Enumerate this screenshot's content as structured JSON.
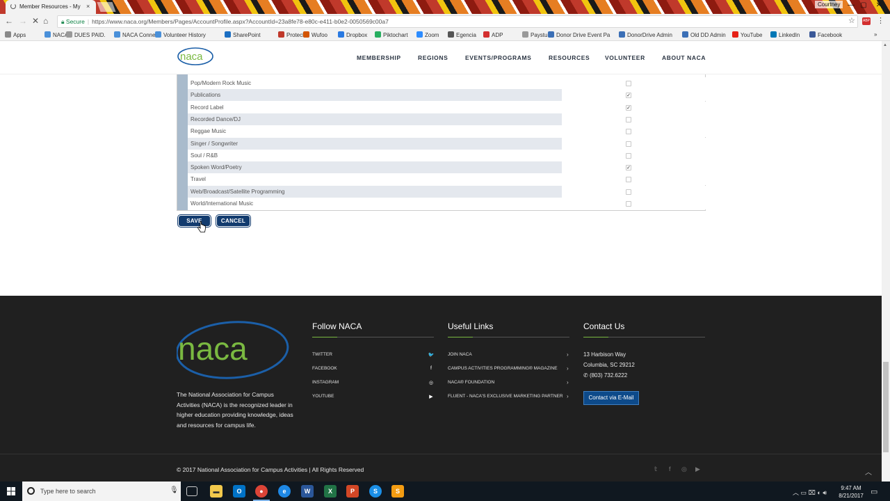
{
  "browser": {
    "tab_title": "Member Resources - My",
    "tab_close": "×",
    "profile": "Courtney",
    "minimize": "—",
    "maximize": "▢",
    "close": "✕",
    "secure_label": "Secure",
    "url": "https://www.naca.org/Members/Pages/AccountProfile.aspx?AccountId=23a8fe78-e80c-e411-b0e2-0050569c00a7",
    "ext_label": "ABP",
    "bookmarks": [
      {
        "label": "Apps",
        "color": "#888"
      },
      {
        "label": "NACA",
        "color": "#4a90d9"
      },
      {
        "label": "DUES PAID.",
        "color": "#999"
      },
      {
        "label": "NACA Connect",
        "color": "#4a90d9"
      },
      {
        "label": "Volunteer History",
        "color": "#4a90d9"
      },
      {
        "label": "SharePoint",
        "color": "#1b6ec2"
      },
      {
        "label": "Protech",
        "color": "#c0392b"
      },
      {
        "label": "Wufoo",
        "color": "#d35400"
      },
      {
        "label": "Dropbox",
        "color": "#2a7ae2"
      },
      {
        "label": "Piktochart",
        "color": "#27ae60"
      },
      {
        "label": "Zoom",
        "color": "#2d8cff"
      },
      {
        "label": "Egencia",
        "color": "#555"
      },
      {
        "label": "ADP",
        "color": "#d32f2f"
      },
      {
        "label": "Paystub",
        "color": "#999"
      },
      {
        "label": "Donor Drive Event Pa",
        "color": "#3b6fb6"
      },
      {
        "label": "DonorDrive Admin",
        "color": "#3b6fb6"
      },
      {
        "label": "Old DD Admin",
        "color": "#3b6fb6"
      },
      {
        "label": "YouTube",
        "color": "#e62117"
      },
      {
        "label": "LinkedIn",
        "color": "#0077b5"
      },
      {
        "label": "Facebook",
        "color": "#3b5998"
      }
    ],
    "more": "»"
  },
  "site": {
    "logo_text": "naca",
    "nav": [
      "MEMBERSHIP",
      "REGIONS",
      "EVENTS/PROGRAMS",
      "RESOURCES",
      "VOLUNTEER",
      "ABOUT NACA"
    ]
  },
  "table": {
    "rows": [
      {
        "label": "Pop/Modern Rock Music",
        "checked": false
      },
      {
        "label": "Publications",
        "checked": true
      },
      {
        "label": "Record Label",
        "checked": true
      },
      {
        "label": "Recorded Dance/DJ",
        "checked": false
      },
      {
        "label": "Reggae Music",
        "checked": false
      },
      {
        "label": "Singer / Songwriter",
        "checked": false
      },
      {
        "label": "Soul / R&B",
        "checked": false
      },
      {
        "label": "Spoken Word/Poetry",
        "checked": true
      },
      {
        "label": "Travel",
        "checked": false
      },
      {
        "label": "Web/Broadcast/Satellite Programming",
        "checked": false
      },
      {
        "label": "World/International Music",
        "checked": false
      }
    ]
  },
  "actions": {
    "save": "SAVE",
    "cancel": "CANCEL"
  },
  "footer": {
    "logo_text": "naca",
    "about": "The National Association for Campus Activities (NACA) is the recognized leader in higher education providing knowledge, ideas and resources for campus life.",
    "follow_title": "Follow NACA",
    "follow_links": [
      {
        "label": "TWITTER",
        "icon": "twitter-icon",
        "glyph": "🐦"
      },
      {
        "label": "FACEBOOK",
        "icon": "facebook-icon",
        "glyph": "f"
      },
      {
        "label": "INSTAGRAM",
        "icon": "instagram-icon",
        "glyph": "◎"
      },
      {
        "label": "YOUTUBE",
        "icon": "youtube-icon",
        "glyph": "▶"
      }
    ],
    "useful_title": "Useful Links",
    "useful_links": [
      "JOIN NACA",
      "CAMPUS ACTIVITIES PROGRAMMING® MAGAZINE",
      "NACA® FOUNDATION",
      "FLUENT - NACA'S EXCLUSIVE MARKETING PARTNER"
    ],
    "contact_title": "Contact Us",
    "address1": "13 Harbison Way",
    "address2": "Columbia, SC 29212",
    "phone": "(803) 732.6222",
    "email_button": "Contact via E-Mail",
    "copyright": "© 2017 National Association for Campus Activities | All Rights Reserved"
  },
  "taskbar": {
    "search_placeholder": "Type here to search",
    "time": "9:47 AM",
    "date": "8/21/2017"
  },
  "colors": {
    "brand_navy": "#123b6e",
    "brand_green": "#7ab941",
    "brand_blue": "#1b5fa8",
    "footer_bg": "#202020"
  }
}
